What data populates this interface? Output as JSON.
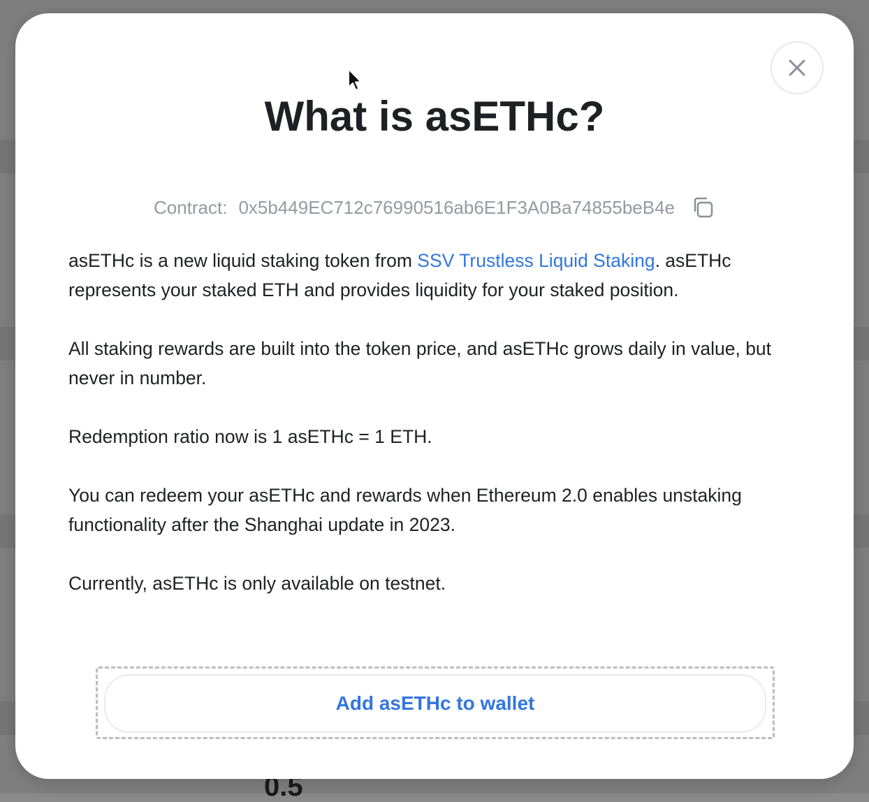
{
  "background": {
    "partial_value": "0.5"
  },
  "modal": {
    "title": "What is asETHc?",
    "close_label": "×",
    "contract": {
      "label": "Contract:",
      "address": "0x5b449EC712c76990516ab6E1F3A0Ba74855beB4e"
    },
    "paragraphs": {
      "p1_prefix": "asETHc is a new liquid staking token from ",
      "p1_link": "SSV Trustless Liquid Staking",
      "p1_suffix": ". asETHc represents your staked ETH and provides liquidity for your staked position.",
      "p2": "All staking rewards are built into the token price, and asETHc grows daily in value, but never in number.",
      "p3": "Redemption ratio now is 1 asETHc = 1 ETH.",
      "p4": "You can redeem your asETHc and rewards when Ethereum 2.0 enables unstaking functionality after the Shanghai update in 2023.",
      "p5": "Currently, asETHc is only available on testnet."
    },
    "add_button_label": "Add asETHc to wallet"
  },
  "colors": {
    "link": "#3375e0",
    "muted": "#9599a1",
    "text": "#1e2024",
    "overlay": "#7f7f7f"
  },
  "icons": {
    "close": "close-icon",
    "copy": "copy-icon",
    "cursor": "mouse-pointer-icon"
  }
}
